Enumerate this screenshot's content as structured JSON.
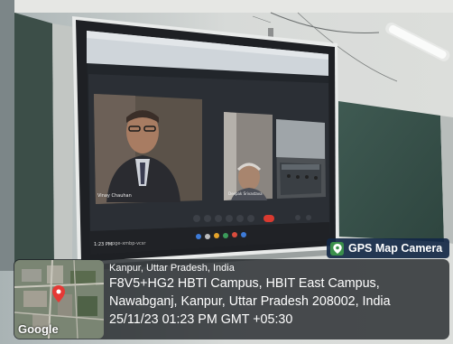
{
  "meeting": {
    "tile_1_name": "Vinay Chauhan",
    "tile_2_name": "Deepak Srivastava",
    "taskbar_time": "1:23 PM",
    "taskbar_code": "pge-xmbp-vcsr"
  },
  "gps_badge": {
    "label": "GPS Map Camera",
    "icon": "map-pin-icon"
  },
  "location": {
    "city": "Kanpur, Uttar Pradesh, India",
    "line1": "F8V5+HG2 HBTI Campus, HBIT East Campus,",
    "line2": "Nawabganj, Kanpur, Uttar Pradesh 208002, India",
    "datetime": "25/11/23 01:23 PM GMT +05:30"
  },
  "map": {
    "brand": "Google",
    "pin_icon": "map-pin-icon"
  },
  "colors": {
    "overlay": "#1c2024",
    "badge": "#142846",
    "pin": "#e53935"
  }
}
